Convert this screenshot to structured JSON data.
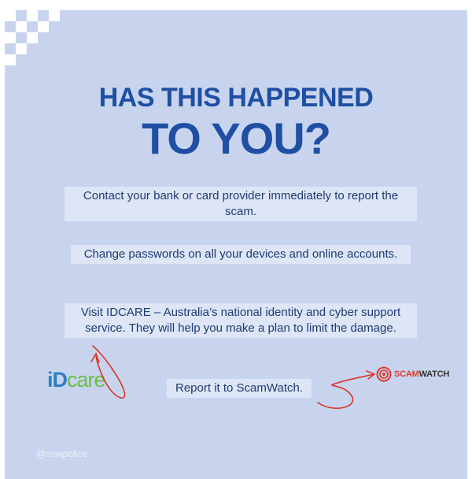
{
  "headline": {
    "line1": "HAS THIS HAPPENED",
    "line2": "TO YOU?"
  },
  "steps": [
    "Contact your bank or card provider immediately to report the scam.",
    "Change passwords on all your devices and online accounts.",
    "Visit IDCARE – Australia’s national identity and cyber support service. They will help you make a plan to limit the damage.",
    "Report it to ScamWatch."
  ],
  "logos": {
    "idcare": {
      "id": "iD",
      "care": "care"
    },
    "scamwatch": {
      "scam": "SCAM",
      "watch": "WATCH"
    }
  },
  "handle": "@nswpolice",
  "colors": {
    "background": "#c8d4ee",
    "headline": "#1f4fa3",
    "highlight": "#dde5f6",
    "arrow": "#d6362b",
    "idcare_blue": "#2d7fc4",
    "idcare_green": "#6cbd45"
  }
}
